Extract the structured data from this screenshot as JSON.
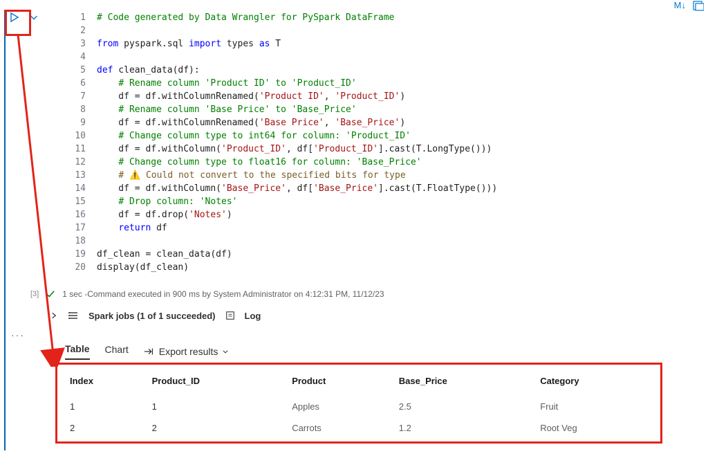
{
  "toolbar": {
    "markdown_label": "M↓",
    "chevron_glyph": "⌄"
  },
  "code": {
    "lines": [
      {
        "n": 1,
        "segs": [
          {
            "cls": "c-comment",
            "t": "# Code generated by Data Wrangler for PySpark DataFrame"
          }
        ]
      },
      {
        "n": 2,
        "segs": [
          {
            "cls": "",
            "t": ""
          }
        ]
      },
      {
        "n": 3,
        "segs": [
          {
            "cls": "c-kw",
            "t": "from"
          },
          {
            "cls": "",
            "t": " pyspark.sql "
          },
          {
            "cls": "c-kw",
            "t": "import"
          },
          {
            "cls": "",
            "t": " types "
          },
          {
            "cls": "c-kw",
            "t": "as"
          },
          {
            "cls": "",
            "t": " T"
          }
        ]
      },
      {
        "n": 4,
        "segs": [
          {
            "cls": "",
            "t": ""
          }
        ]
      },
      {
        "n": 5,
        "segs": [
          {
            "cls": "c-kw",
            "t": "def"
          },
          {
            "cls": "",
            "t": " clean_data(df):"
          }
        ]
      },
      {
        "n": 6,
        "segs": [
          {
            "cls": "",
            "t": "    "
          },
          {
            "cls": "c-comment",
            "t": "# Rename column 'Product ID' to 'Product_ID'"
          }
        ]
      },
      {
        "n": 7,
        "segs": [
          {
            "cls": "",
            "t": "    df = df.withColumnRenamed("
          },
          {
            "cls": "c-str",
            "t": "'Product ID'"
          },
          {
            "cls": "",
            "t": ", "
          },
          {
            "cls": "c-str",
            "t": "'Product_ID'"
          },
          {
            "cls": "",
            "t": ")"
          }
        ]
      },
      {
        "n": 8,
        "segs": [
          {
            "cls": "",
            "t": "    "
          },
          {
            "cls": "c-comment",
            "t": "# Rename column 'Base Price' to 'Base_Price'"
          }
        ]
      },
      {
        "n": 9,
        "segs": [
          {
            "cls": "",
            "t": "    df = df.withColumnRenamed("
          },
          {
            "cls": "c-str",
            "t": "'Base Price'"
          },
          {
            "cls": "",
            "t": ", "
          },
          {
            "cls": "c-str",
            "t": "'Base_Price'"
          },
          {
            "cls": "",
            "t": ")"
          }
        ]
      },
      {
        "n": 10,
        "segs": [
          {
            "cls": "",
            "t": "    "
          },
          {
            "cls": "c-comment",
            "t": "# Change column type to int64 for column: 'Product_ID'"
          }
        ]
      },
      {
        "n": 11,
        "segs": [
          {
            "cls": "",
            "t": "    df = df.withColumn("
          },
          {
            "cls": "c-str",
            "t": "'Product_ID'"
          },
          {
            "cls": "",
            "t": ", df["
          },
          {
            "cls": "c-str",
            "t": "'Product_ID'"
          },
          {
            "cls": "",
            "t": "].cast(T.LongType()))"
          }
        ]
      },
      {
        "n": 12,
        "segs": [
          {
            "cls": "",
            "t": "    "
          },
          {
            "cls": "c-comment",
            "t": "# Change column type to float16 for column: 'Base_Price'"
          }
        ]
      },
      {
        "n": 13,
        "segs": [
          {
            "cls": "",
            "t": "    "
          },
          {
            "cls": "c-warn",
            "t": "# ⚠️ Could not convert to the specified bits for type"
          }
        ]
      },
      {
        "n": 14,
        "segs": [
          {
            "cls": "",
            "t": "    df = df.withColumn("
          },
          {
            "cls": "c-str",
            "t": "'Base_Price'"
          },
          {
            "cls": "",
            "t": ", df["
          },
          {
            "cls": "c-str",
            "t": "'Base_Price'"
          },
          {
            "cls": "",
            "t": "].cast(T.FloatType()))"
          }
        ]
      },
      {
        "n": 15,
        "segs": [
          {
            "cls": "",
            "t": "    "
          },
          {
            "cls": "c-comment",
            "t": "# Drop column: 'Notes'"
          }
        ]
      },
      {
        "n": 16,
        "segs": [
          {
            "cls": "",
            "t": "    df = df.drop("
          },
          {
            "cls": "c-str",
            "t": "'Notes'"
          },
          {
            "cls": "",
            "t": ")"
          }
        ]
      },
      {
        "n": 17,
        "segs": [
          {
            "cls": "",
            "t": "    "
          },
          {
            "cls": "c-kw",
            "t": "return"
          },
          {
            "cls": "",
            "t": " df"
          }
        ]
      },
      {
        "n": 18,
        "segs": [
          {
            "cls": "",
            "t": ""
          }
        ]
      },
      {
        "n": 19,
        "segs": [
          {
            "cls": "",
            "t": "df_clean = clean_data(df)"
          }
        ]
      },
      {
        "n": 20,
        "segs": [
          {
            "cls": "",
            "t": "display(df_clean)"
          }
        ]
      }
    ]
  },
  "execution": {
    "count_label": "[3]",
    "status_text": "1 sec -Command executed in 900 ms by System Administrator on 4:12:31 PM, 11/12/23"
  },
  "spark": {
    "label": "Spark jobs (1 of 1 succeeded)",
    "log_label": "Log"
  },
  "tabs": {
    "table": "Table",
    "chart": "Chart",
    "export": "Export results"
  },
  "results": {
    "headers": [
      "Index",
      "Product_ID",
      "Product",
      "Base_Price",
      "Category"
    ],
    "rows": [
      [
        "1",
        "1",
        "Apples",
        "2.5",
        "Fruit"
      ],
      [
        "2",
        "2",
        "Carrots",
        "1.2",
        "Root Veg"
      ]
    ]
  }
}
